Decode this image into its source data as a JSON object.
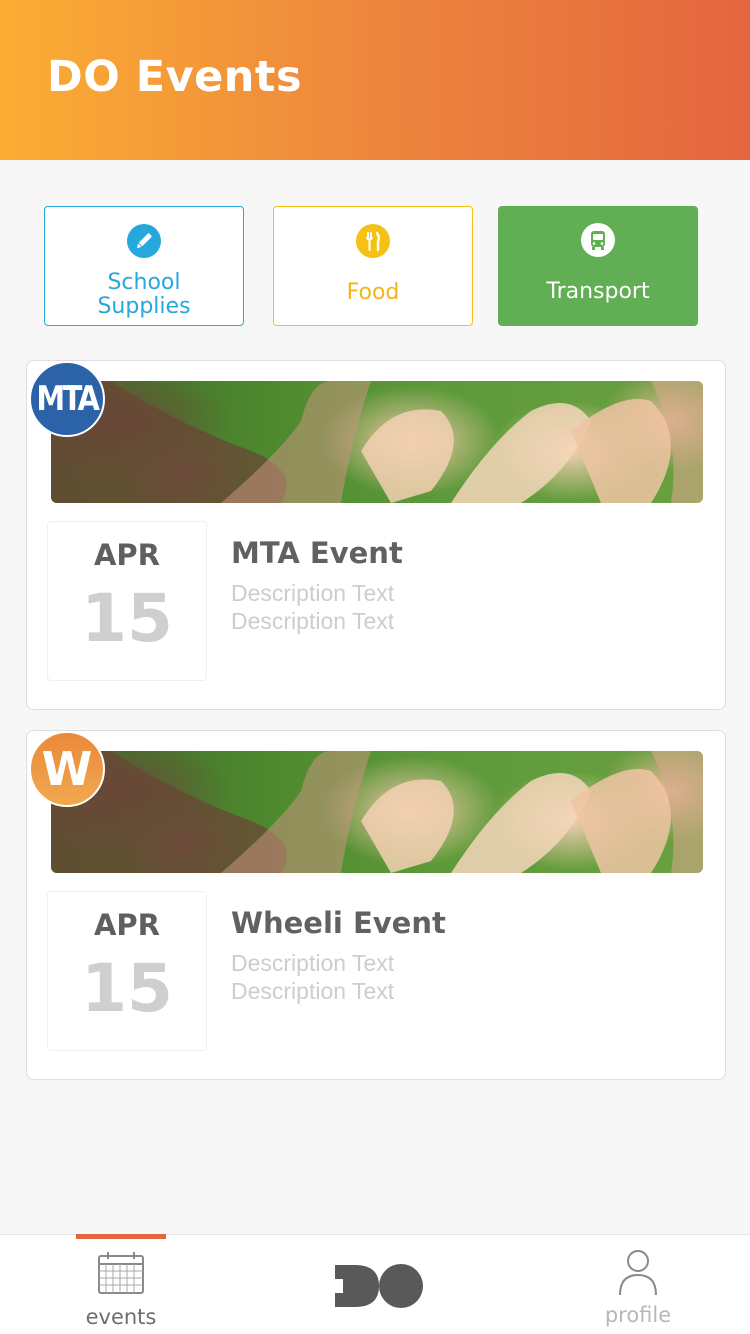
{
  "header": {
    "title": "DO Events"
  },
  "categories": [
    {
      "label": "School Supplies",
      "icon": "pencil-icon",
      "color": "#27a8dc"
    },
    {
      "label": "Food",
      "icon": "fork-knife-icon",
      "color": "#f5c213"
    },
    {
      "label": "Transport",
      "icon": "bus-icon",
      "color": "#62ae55",
      "selected": true
    }
  ],
  "events": [
    {
      "badge_text": "MTA",
      "month": "APR",
      "day": "15",
      "title": "MTA Event",
      "desc1": "Description Text",
      "desc2": "Description Text"
    },
    {
      "badge_text": "W",
      "month": "APR",
      "day": "15",
      "title": "Wheeli Event",
      "desc1": "Description Text",
      "desc2": "Description Text"
    }
  ],
  "tabbar": {
    "events_label": "events",
    "profile_label": "profile",
    "active_color": "#e4663f",
    "active_tab": "events"
  }
}
